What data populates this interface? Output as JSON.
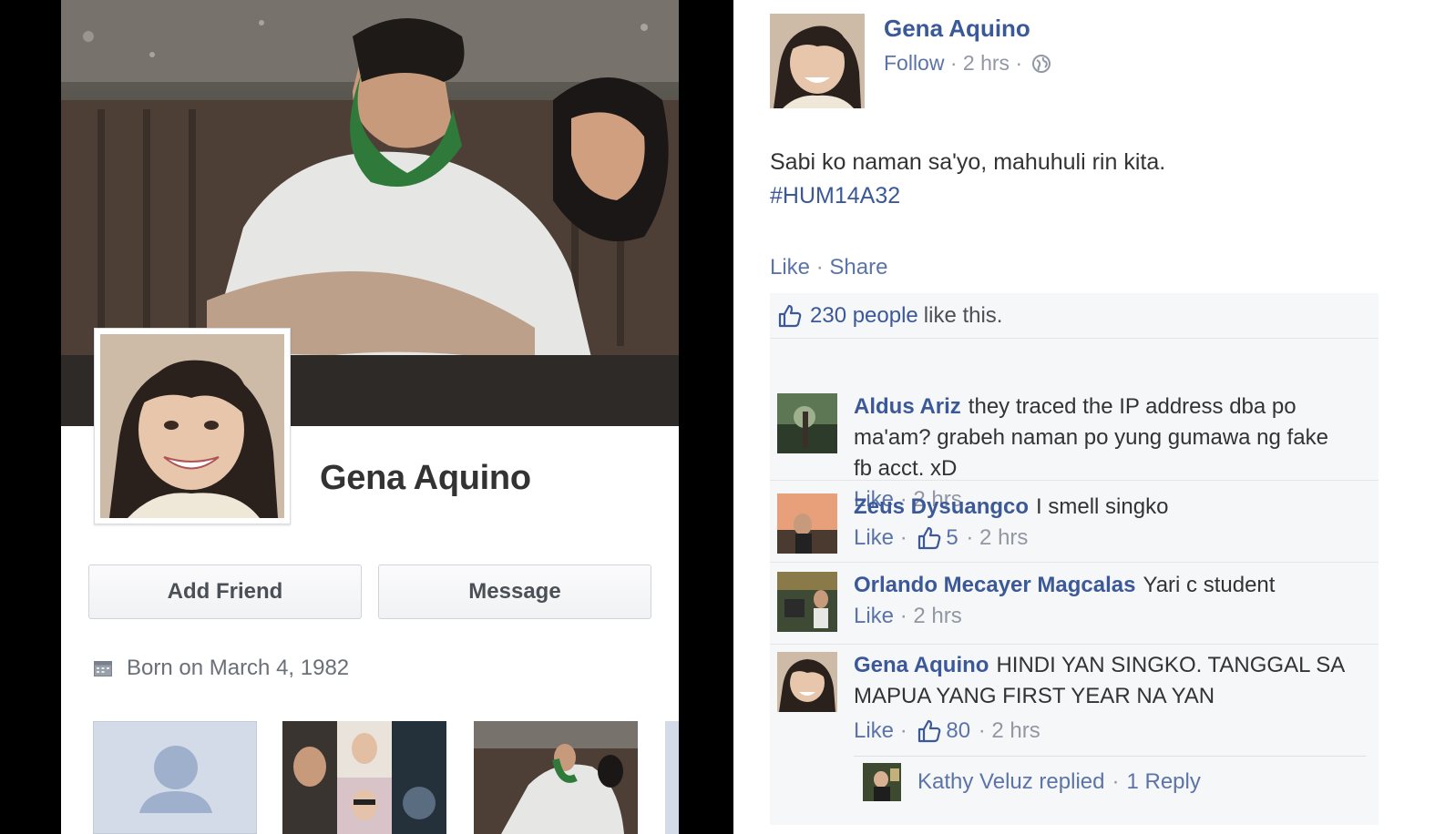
{
  "profile": {
    "name": "Gena Aquino",
    "add_friend_label": "Add Friend",
    "message_label": "Message",
    "born": "Born on March 4, 1982",
    "icons": {
      "calendar": "calendar-icon",
      "placeholder": "person-silhouette-icon"
    }
  },
  "post": {
    "author": "Gena Aquino",
    "follow": "Follow",
    "time": "2 hrs",
    "text": "Sabi ko naman sa'yo, mahuhuli rin kita.",
    "hashtag": "#HUM14A32",
    "like": "Like",
    "share": "Share",
    "likes_count": "230 people",
    "likes_suffix": "like this.",
    "comments": [
      {
        "name": "Aldus Ariz",
        "text": "they traced the IP address dba po ma'am? grabeh naman po yung gumawa ng fake fb acct. xD",
        "like": "Like",
        "time": "2 hrs",
        "likes": ""
      },
      {
        "name": "Zeus Dysuangco",
        "text": "I smell singko",
        "like": "Like",
        "time": "2 hrs",
        "likes": "5"
      },
      {
        "name": "Orlando Mecayer Magcalas",
        "text": "Yari c student",
        "like": "Like",
        "time": "2 hrs",
        "likes": ""
      },
      {
        "name": "Gena Aquino",
        "text": "HINDI YAN SINGKO. TANGGAL SA MAPUA YANG FIRST YEAR NA YAN",
        "like": "Like",
        "time": "2 hrs",
        "likes": "80"
      }
    ],
    "reply": {
      "text": "Kathy Veluz replied",
      "sep": "·",
      "count": "1 Reply"
    }
  },
  "colors": {
    "link": "#3b5998",
    "meta": "#9197a3",
    "ufi_bg": "#f6f7f9"
  }
}
